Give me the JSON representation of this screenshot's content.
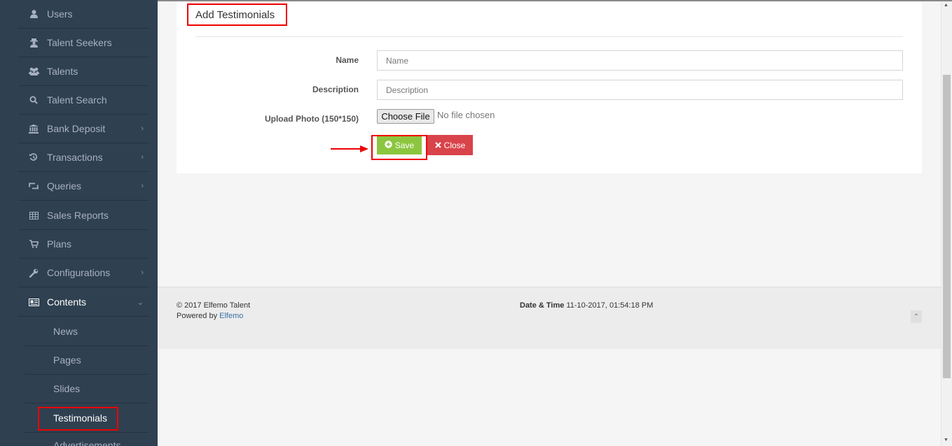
{
  "sidebar": {
    "items": [
      {
        "label": "Users",
        "icon": "user-icon"
      },
      {
        "label": "Talent Seekers",
        "icon": "user-secret-icon"
      },
      {
        "label": "Talents",
        "icon": "users-icon"
      },
      {
        "label": "Talent Search",
        "icon": "search-icon"
      },
      {
        "label": "Bank Deposit",
        "icon": "bank-icon"
      },
      {
        "label": "Transactions",
        "icon": "history-icon"
      },
      {
        "label": "Queries",
        "icon": "retweet-icon"
      },
      {
        "label": "Sales Reports",
        "icon": "table-icon"
      },
      {
        "label": "Plans",
        "icon": "cart-icon"
      },
      {
        "label": "Configurations",
        "icon": "wrench-icon"
      },
      {
        "label": "Contents",
        "icon": "newspaper-icon"
      }
    ],
    "sub_items": [
      {
        "label": "News"
      },
      {
        "label": "Pages"
      },
      {
        "label": "Slides"
      },
      {
        "label": "Testimonials"
      },
      {
        "label": "Advertisements"
      }
    ]
  },
  "form": {
    "title": "Add Testimonials",
    "name_label": "Name",
    "name_placeholder": "Name",
    "description_label": "Description",
    "description_placeholder": "Description",
    "photo_label": "Upload Photo (150*150)",
    "file_button": "Choose File",
    "file_status": "No file chosen",
    "save_label": "Save",
    "close_label": "Close"
  },
  "footer": {
    "copyright": "© 2017 Elfemo Talent",
    "powered_prefix": "Powered by",
    "powered_link": "Elfemo",
    "datetime_label": "Date & Time",
    "datetime_value": "11-10-2017, 01:54:18 PM"
  },
  "colors": {
    "sidebar_bg": "#2f4050",
    "save_green": "#8cc63f",
    "close_red": "#d9434a",
    "highlight_red": "#e00000"
  }
}
